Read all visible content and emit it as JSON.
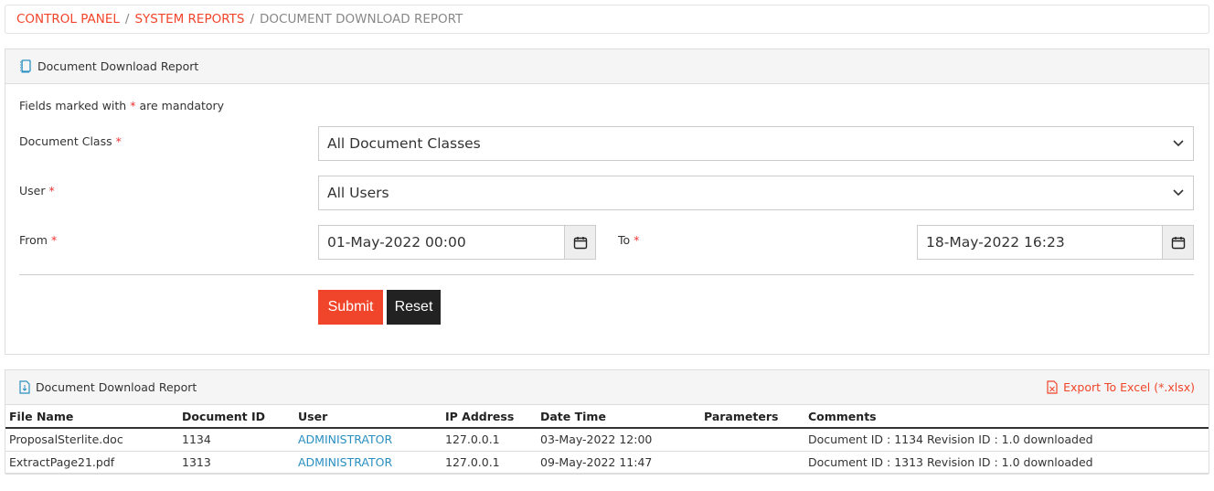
{
  "breadcrumb": {
    "items": [
      "CONTROL PANEL",
      "SYSTEM REPORTS"
    ],
    "current": "DOCUMENT DOWNLOAD REPORT",
    "separator": "/"
  },
  "form": {
    "title": "Document Download Report",
    "note_before": "Fields marked with",
    "note_star": "*",
    "note_after": "are mandatory",
    "doc_class_label": "Document Class",
    "doc_class_value": "All Document Classes",
    "user_label": "User",
    "user_value": "All Users",
    "from_label": "From",
    "from_value": "01-May-2022 00:00",
    "to_label": "To",
    "to_value": "18-May-2022 16:23",
    "submit": "Submit",
    "reset": "Reset"
  },
  "colors": {
    "accent": "#f0452a",
    "link": "#2a8fc1",
    "dark": "#222222"
  },
  "results": {
    "title": "Document Download Report",
    "export": "Export To Excel (*.xlsx)",
    "columns": [
      "File Name",
      "Document ID",
      "User",
      "IP Address",
      "Date Time",
      "Parameters",
      "Comments"
    ],
    "rows": [
      {
        "file": "ProposalSterlite.doc",
        "id": "1134",
        "user": "ADMINISTRATOR",
        "ip": "127.0.0.1",
        "dt": "03-May-2022 12:00",
        "params": "",
        "comments": "Document ID : 1134 Revision ID : 1.0 downloaded"
      },
      {
        "file": "ExtractPage21.pdf",
        "id": "1313",
        "user": "ADMINISTRATOR",
        "ip": "127.0.0.1",
        "dt": "09-May-2022 11:47",
        "params": "",
        "comments": "Document ID : 1313 Revision ID : 1.0 downloaded"
      }
    ]
  }
}
